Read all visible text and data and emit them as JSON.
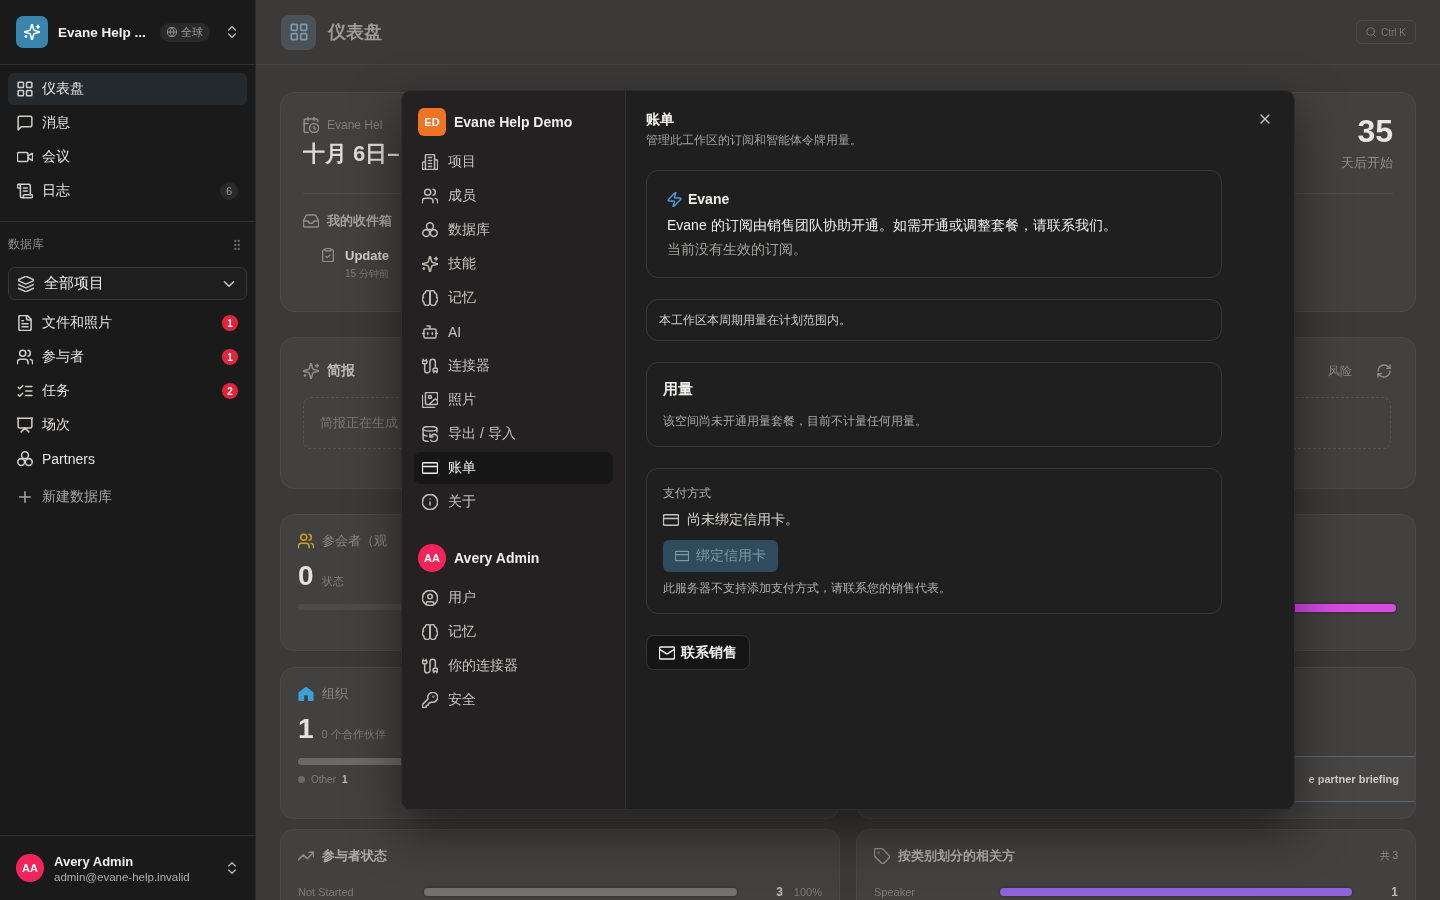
{
  "sidebar": {
    "workspace": {
      "name": "Evane Help ...",
      "scope": "全球"
    },
    "nav": [
      {
        "label": "仪表盘",
        "selected": true
      },
      {
        "label": "消息",
        "selected": false
      },
      {
        "label": "会议",
        "selected": false
      },
      {
        "label": "日志",
        "selected": false,
        "count": "6"
      }
    ],
    "section_label": "数据库",
    "database_select": {
      "value": "全部项目"
    },
    "databases": [
      {
        "label": "文件和照片",
        "badge": "1"
      },
      {
        "label": "参与者",
        "badge": "1"
      },
      {
        "label": "任务",
        "badge": "2"
      },
      {
        "label": "场次"
      },
      {
        "label": "Partners"
      }
    ],
    "new_database": "新建数据库",
    "user": {
      "initials": "AA",
      "name": "Avery Admin",
      "email": "admin@evane-help.invalid"
    }
  },
  "header": {
    "title": "仪表盘",
    "search_shortcut": "Ctrl K"
  },
  "dashboard": {
    "event_card": {
      "workspace": "Evane Hel",
      "date": "十月 6日–",
      "countdown": "35",
      "countdown_label": "天后开始",
      "inbox_title": "我的收件箱",
      "inbox_items": [
        {
          "title": "Update",
          "time": "15 分钟前"
        }
      ]
    },
    "briefing_card": {
      "title": "简报",
      "filters": [
        "风险"
      ],
      "status": "简报正在生成"
    },
    "attendee_card": {
      "title": "参会者（观",
      "count": "0",
      "count_label": "状态"
    },
    "progress_card": {
      "level": 1
    },
    "org_card": {
      "title": "组织",
      "count": "1",
      "count_label": "0 个合作伙伴",
      "legend": [
        {
          "label": "Other",
          "value": "1"
        }
      ]
    },
    "briefing_item_card": {
      "items": [
        {
          "title": "e partner briefing"
        }
      ]
    },
    "status_card": {
      "title": "参与者状态",
      "rows": [
        {
          "label": "Not Started",
          "level": 1,
          "value": "3",
          "percent": "100%"
        }
      ]
    },
    "category_card": {
      "title": "按类别划分的相关方",
      "total": "共 3",
      "rows": [
        {
          "label": "Speaker",
          "level": 1,
          "value": "1"
        }
      ]
    }
  },
  "settings_dialog": {
    "workspace": {
      "initials": "ED",
      "name": "Evane Help Demo"
    },
    "workspace_nav": [
      {
        "label": "项目",
        "selected": false
      },
      {
        "label": "成员",
        "selected": false
      },
      {
        "label": "数据库",
        "selected": false
      },
      {
        "label": "技能",
        "selected": false
      },
      {
        "label": "记忆",
        "selected": false
      },
      {
        "label": "AI",
        "selected": false
      },
      {
        "label": "连接器",
        "selected": false
      },
      {
        "label": "照片",
        "selected": false
      },
      {
        "label": "导出 / 导入",
        "selected": false
      },
      {
        "label": "账单",
        "selected": true
      },
      {
        "label": "关于",
        "selected": false
      }
    ],
    "account": {
      "initials": "AA",
      "name": "Avery Admin"
    },
    "account_nav": [
      {
        "label": "用户",
        "selected": false
      },
      {
        "label": "记忆",
        "selected": false
      },
      {
        "label": "你的连接器",
        "selected": false
      },
      {
        "label": "安全",
        "selected": false
      }
    ],
    "title": "账单",
    "subtitle": "管理此工作区的订阅和智能体令牌用量。",
    "plan_card": {
      "name": "Evane",
      "description": "Evane 的订阅由销售团队协助开通。如需开通或调整套餐，请联系我们。",
      "status": "当前没有生效的订阅。"
    },
    "usage_notice": "本工作区本周期用量在计划范围内。",
    "usage_card": {
      "title": "用量",
      "description": "该空间尚未开通用量套餐，目前不计量任何用量。"
    },
    "payment_card": {
      "title": "支付方式",
      "card_status": "尚未绑定信用卡。",
      "bind_button": {
        "label": "绑定信用卡",
        "disabled": true
      },
      "note": "此服务器不支持添加支付方式，请联系您的销售代表。"
    },
    "contact_button": {
      "label": "联系销售"
    }
  }
}
